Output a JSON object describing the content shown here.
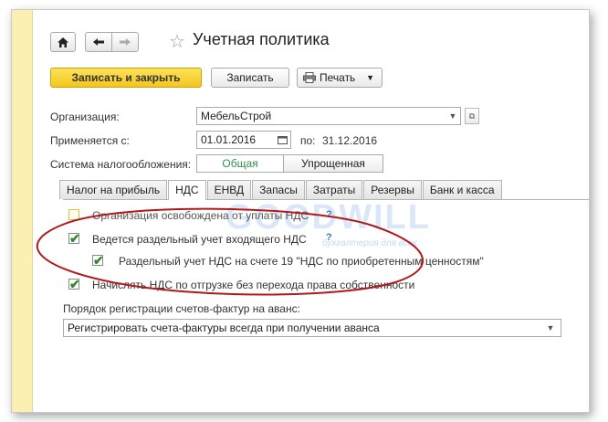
{
  "header": {
    "title": "Учетная политика"
  },
  "toolbar": {
    "save_close_label": "Записать и закрыть",
    "save_label": "Записать",
    "print_label": "Печать"
  },
  "form": {
    "org_label": "Организация:",
    "org_value": "МебельСтрой",
    "applies_label": "Применяется с:",
    "date_from": "01.01.2016",
    "to_label": "по:",
    "date_to": "31.12.2016",
    "tax_system_label": "Система налогообложения:",
    "tax_system_options": [
      "Общая",
      "Упрощенная"
    ],
    "tax_system_selected": "Общая"
  },
  "tabs": [
    {
      "label": "Налог на прибыль",
      "active": false
    },
    {
      "label": "НДС",
      "active": true
    },
    {
      "label": "ЕНВД",
      "active": false
    },
    {
      "label": "Запасы",
      "active": false
    },
    {
      "label": "Затраты",
      "active": false
    },
    {
      "label": "Резервы",
      "active": false
    },
    {
      "label": "Банк и касса",
      "active": false
    }
  ],
  "vat": {
    "exempt_label": "Организация освобождена от уплаты НДС",
    "exempt_checked": false,
    "separate_label": "Ведется раздельный учет входящего НДС",
    "separate_checked": true,
    "account19_label": "Раздельный учет НДС на счете 19 \"НДС по приобретенным ценностям\"",
    "account19_checked": true,
    "shipment_label": "Начислять НДС по отгрузке без перехода права собственности",
    "shipment_checked": true,
    "help_mark": "?",
    "invoice_order_label": "Порядок регистрации счетов-фактур на аванс:",
    "invoice_order_value": "Регистрировать счета-фактуры всегда при получении аванса"
  },
  "watermark": {
    "text": "GOODWILL",
    "subtext": "бухгалтерия для всех"
  },
  "colors": {
    "primary_button": "#f3c61d",
    "accent_strip": "#fbefb3",
    "annotation_oval": "#b0181c",
    "check": "#2a8a2a",
    "selected_toggle_text": "#2f8f4a"
  },
  "icons": {
    "home": "home-icon",
    "back": "arrow-left-icon",
    "forward": "arrow-right-icon",
    "favorite": "star-icon",
    "print": "printer-icon",
    "calendar": "calendar-icon"
  }
}
